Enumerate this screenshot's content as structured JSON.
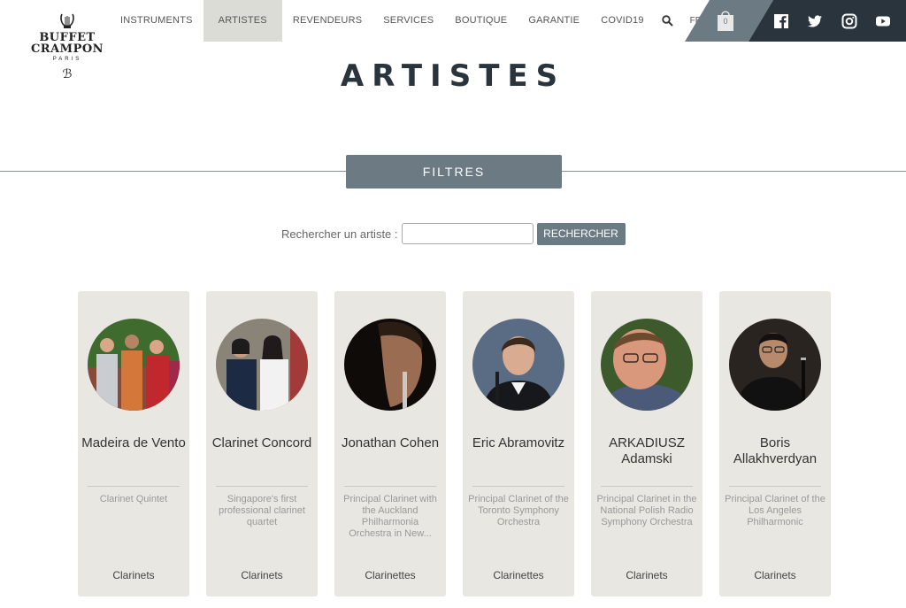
{
  "logo": {
    "line1": "BUFFET",
    "line2": "CRAMPON",
    "line3": "PARIS",
    "monogram": "ℬ"
  },
  "nav": {
    "items": [
      "INSTRUMENTS",
      "ARTISTES",
      "REVENDEURS",
      "SERVICES",
      "BOUTIQUE",
      "GARANTIE",
      "COVID19"
    ],
    "active": "ARTISTES",
    "language": "FRANÇAIS"
  },
  "cart": {
    "count": "0"
  },
  "social": [
    "facebook-icon",
    "twitter-icon",
    "instagram-icon",
    "youtube-icon"
  ],
  "page": {
    "title": "ARTISTES"
  },
  "filters": {
    "label": "FILTRES"
  },
  "search": {
    "label": "Rechercher un artiste :",
    "value": "",
    "button": "RECHERCHER"
  },
  "artists": [
    {
      "name": "Madeira de Vento",
      "description": "Clarinet Quintet",
      "category": "Clarinets"
    },
    {
      "name": "Clarinet Concord",
      "description": "Singapore's first professional clarinet quartet",
      "category": "Clarinets"
    },
    {
      "name": "Jonathan Cohen",
      "description": "Principal Clarinet with the Auckland Philharmonia Orchestra in New...",
      "category": "Clarinettes"
    },
    {
      "name": "Eric Abramovitz",
      "description": "Principal Clarinet of the Toronto Symphony Orchestra",
      "category": "Clarinettes"
    },
    {
      "name": "ARKADIUSZ Adamski",
      "description": "Principal Clarinet in the National Polish Radio Symphony Orchestra",
      "category": "Clarinets"
    },
    {
      "name": "Boris Allakhverdyan",
      "description": "Principal Clarinet of the Los Angeles Philharmonic",
      "category": "Clarinets"
    }
  ],
  "colors": {
    "accent": "#6b7a83",
    "dark": "#2a343c",
    "card_bg": "#e8e7e1",
    "active_nav": "#dcdcd6"
  }
}
